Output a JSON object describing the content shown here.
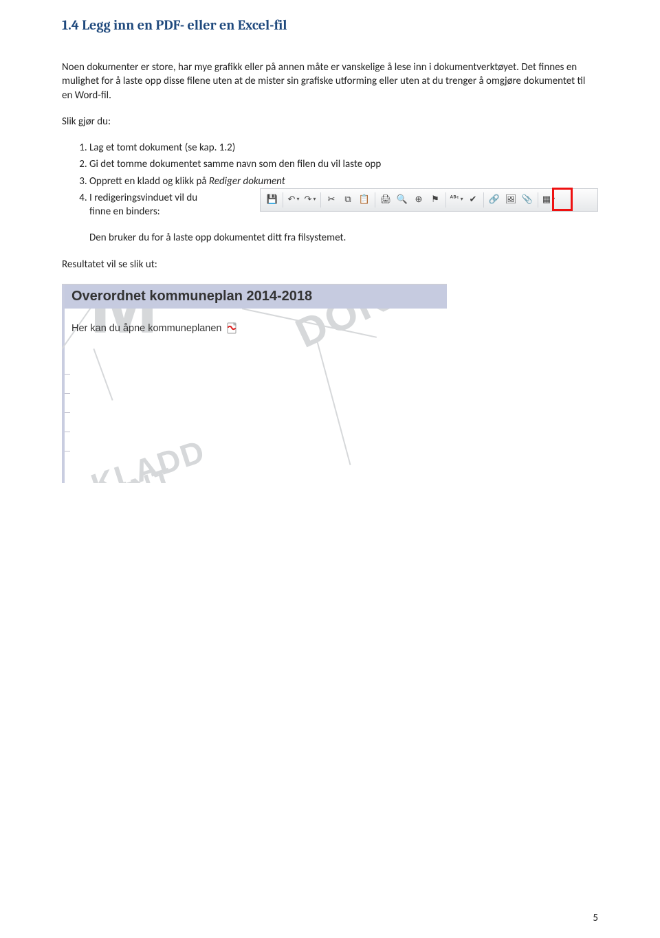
{
  "heading": "1.4 Legg inn en PDF- eller en Excel-fil",
  "para1": "Noen dokumenter er store, har mye grafikk eller på annen måte er vanskelige å lese inn i dokumentverktøyet. Det finnes en mulighet for å laste opp disse filene uten at de mister sin grafiske utforming eller uten at du trenger å omgjøre dokumentet til en Word-fil.",
  "para2": "Slik gjør du:",
  "steps": {
    "s1": "Lag et tomt dokument (se kap. 1.2)",
    "s2": "Gi det tomme dokumentet samme navn som den filen du vil laste opp",
    "s3_pre": "Opprett en kladd og klikk på ",
    "s3_em": "Rediger dokument",
    "s4a": "I redigeringsvinduet vil du",
    "s4b": "finne en binders:"
  },
  "para3": "Den bruker du for å laste opp dokumentet ditt fra filsystemet.",
  "para4": "Resultatet vil se slik ut:",
  "toolbar_icons": {
    "save": "💾",
    "undo": "↶",
    "redo": "↷",
    "cut": "✂",
    "copy": "⧉",
    "paste": "📋",
    "print": "🖨",
    "find": "🔍",
    "zoom": "⊕",
    "flag": "⚑",
    "spell": "ᴬᴮᶜ",
    "check": "✔",
    "link": "🔗",
    "image": "🖼",
    "attach": "📎",
    "table": "▦"
  },
  "result": {
    "title": "Overordnet kommuneplan 2014-2018",
    "body": "Her kan du åpne kommuneplanen"
  },
  "watermarks": {
    "main": "M",
    "doku": "DOKUM",
    "kladd": "KLADD",
    "ent": "ENT"
  },
  "page_number": "5"
}
